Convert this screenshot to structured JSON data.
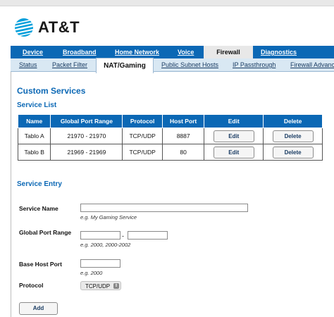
{
  "brand": {
    "name": "AT&T"
  },
  "nav_primary": {
    "tabs": [
      {
        "label": "Device"
      },
      {
        "label": "Broadband"
      },
      {
        "label": "Home Network"
      },
      {
        "label": "Voice"
      },
      {
        "label": "Firewall",
        "active": true
      },
      {
        "label": "Diagnostics"
      }
    ]
  },
  "nav_secondary": {
    "tabs": [
      {
        "label": "Status"
      },
      {
        "label": "Packet Filter"
      },
      {
        "label": "NAT/Gaming",
        "active": true
      },
      {
        "label": "Public Subnet Hosts"
      },
      {
        "label": "IP Passthrough"
      },
      {
        "label": "Firewall Advanced"
      }
    ]
  },
  "page": {
    "title": "Custom Services",
    "service_list_heading": "Service List",
    "service_entry_heading": "Service Entry"
  },
  "service_table": {
    "headers": [
      "Name",
      "Global Port Range",
      "Protocol",
      "Host Port",
      "Edit",
      "Delete"
    ],
    "rows": [
      {
        "name": "Tablo A",
        "range": "21970 - 21970",
        "protocol": "TCP/UDP",
        "host_port": "8887",
        "edit": "Edit",
        "delete": "Delete"
      },
      {
        "name": "Tablo B",
        "range": "21969 - 21969",
        "protocol": "TCP/UDP",
        "host_port": "80",
        "edit": "Edit",
        "delete": "Delete"
      }
    ]
  },
  "form": {
    "service_name": {
      "label": "Service Name",
      "value": "",
      "hint": "e.g. My Gaming Service"
    },
    "global_port_range": {
      "label": "Global Port Range",
      "start_value": "",
      "end_value": "",
      "separator": "-",
      "hint": "e.g. 2000, 2000-2002"
    },
    "base_host_port": {
      "label": "Base Host Port",
      "value": "",
      "hint": "e.g. 2000"
    },
    "protocol": {
      "label": "Protocol",
      "selected": "TCP/UDP",
      "arrows": "⇕"
    },
    "add_button": "Add"
  },
  "colors": {
    "accent": "#0b68b5",
    "subnav_bg": "#d9e8f3",
    "brand_blue": "#009fdb"
  }
}
